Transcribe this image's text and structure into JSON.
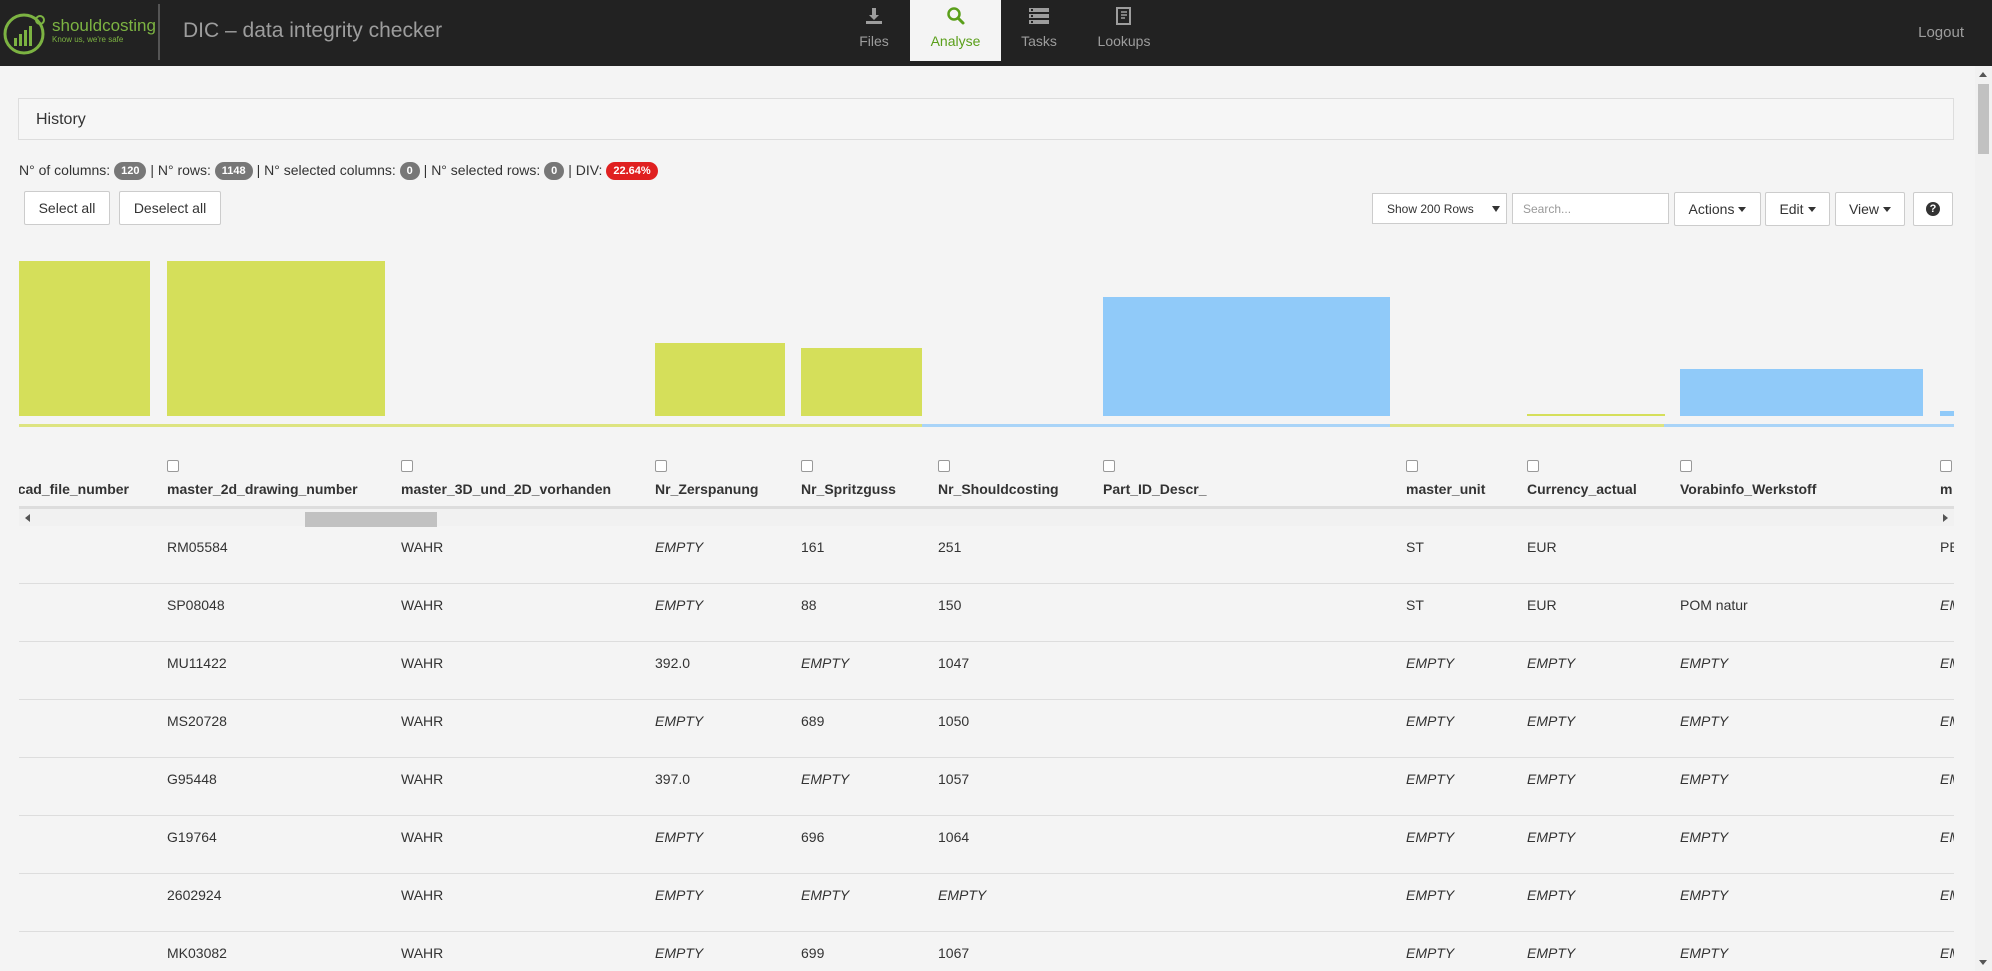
{
  "navbar": {
    "brand": "shouldcosting",
    "brand_tag": "Know us, we're safe",
    "app_title": "DIC – data integrity checker",
    "tabs": [
      {
        "label": "Files",
        "icon": "download-icon"
      },
      {
        "label": "Analyse",
        "icon": "search-icon",
        "active": true
      },
      {
        "label": "Tasks",
        "icon": "server-icon"
      },
      {
        "label": "Lookups",
        "icon": "book-icon"
      }
    ],
    "logout": "Logout"
  },
  "panel": {
    "title": "History"
  },
  "stats": {
    "columns_label": "N° of columns:",
    "columns_value": "120",
    "rows_label": "N° rows:",
    "rows_value": "1148",
    "sel_columns_label": "N° selected columns:",
    "sel_columns_value": "0",
    "sel_rows_label": "N° selected rows:",
    "sel_rows_value": "0",
    "div_label": "DIV:",
    "div_value": "22.64%",
    "separator": "|"
  },
  "toolbar": {
    "select_all": "Select all",
    "deselect_all": "Deselect all",
    "show_rows": "Show 200 Rows",
    "search_placeholder": "Search...",
    "actions": "Actions",
    "edit": "Edit",
    "view": "View",
    "help": "?"
  },
  "chart_data": {
    "type": "bar",
    "colors": {
      "green": "#d5df5a",
      "blue": "#90caf9"
    },
    "ylim": [
      0,
      1
    ],
    "bars": [
      {
        "column": "cad_file_number",
        "value": 1.0,
        "color": "green"
      },
      {
        "column": "master_2d_drawing_number",
        "value": 1.0,
        "color": "green"
      },
      {
        "column": "master_3D_und_2D_vorhanden",
        "value": 0.0,
        "color": "green"
      },
      {
        "column": "Nr_Zerspanung",
        "value": 0.47,
        "color": "green"
      },
      {
        "column": "Nr_Spritzguss",
        "value": 0.44,
        "color": "green"
      },
      {
        "column": "Nr_Shouldcosting",
        "value": 0.0,
        "color": "blue"
      },
      {
        "column": "Part_ID_Descr_",
        "value": 0.77,
        "color": "blue"
      },
      {
        "column": "master_unit",
        "value": 0.0,
        "color": "green"
      },
      {
        "column": "Currency_actual",
        "value": 0.01,
        "color": "green"
      },
      {
        "column": "Vorabinfo_Werkstoff",
        "value": 0.3,
        "color": "blue"
      },
      {
        "column": "m",
        "value": 0.03,
        "color": "blue"
      }
    ]
  },
  "columns": [
    "cad_file_number",
    "master_2d_drawing_number",
    "master_3D_und_2D_vorhanden",
    "Nr_Zerspanung",
    "Nr_Spritzguss",
    "Nr_Shouldcosting",
    "Part_ID_Descr_",
    "master_unit",
    "Currency_actual",
    "Vorabinfo_Werkstoff",
    "m"
  ],
  "rows": [
    [
      "",
      "RM05584",
      "WAHR",
      "EMPTY",
      "161",
      "251",
      "",
      "ST",
      "EUR",
      "",
      "PE"
    ],
    [
      "",
      "SP08048",
      "WAHR",
      "EMPTY",
      "88",
      "150",
      "",
      "ST",
      "EUR",
      "POM natur",
      "EMPTY"
    ],
    [
      "",
      "MU11422",
      "WAHR",
      "392.0",
      "EMPTY",
      "1047",
      "",
      "EMPTY",
      "EMPTY",
      "EMPTY",
      "EMPTY"
    ],
    [
      "",
      "MS20728",
      "WAHR",
      "EMPTY",
      "689",
      "1050",
      "",
      "EMPTY",
      "EMPTY",
      "EMPTY",
      "EMPTY"
    ],
    [
      "",
      "G95448",
      "WAHR",
      "397.0",
      "EMPTY",
      "1057",
      "",
      "EMPTY",
      "EMPTY",
      "EMPTY",
      "EMPTY"
    ],
    [
      "",
      "G19764",
      "WAHR",
      "EMPTY",
      "696",
      "1064",
      "",
      "EMPTY",
      "EMPTY",
      "EMPTY",
      "EMPTY"
    ],
    [
      "",
      "2602924",
      "WAHR",
      "EMPTY",
      "EMPTY",
      "EMPTY",
      "",
      "EMPTY",
      "EMPTY",
      "EMPTY",
      "EMPTY"
    ],
    [
      "",
      "MK03082",
      "WAHR",
      "EMPTY",
      "699",
      "1067",
      "",
      "EMPTY",
      "EMPTY",
      "EMPTY",
      "EMPTY"
    ]
  ]
}
